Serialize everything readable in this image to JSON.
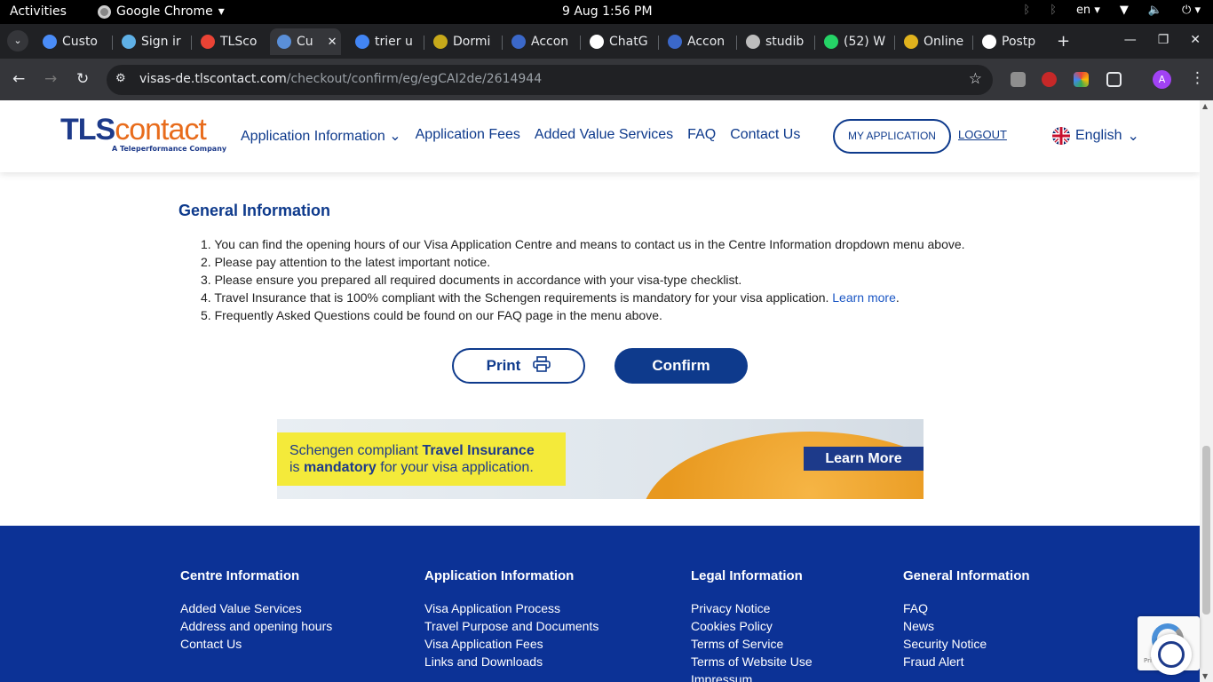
{
  "system_bar": {
    "activities": "Activities",
    "app_name": "Google Chrome",
    "clock": "9 Aug  1:56 PM",
    "language": "en"
  },
  "tabs": [
    {
      "label": "Custo",
      "color": "#4a8cf7"
    },
    {
      "label": "Sign ir",
      "color": "#5fb0e6"
    },
    {
      "label": "TLSco",
      "color": "#ea4335"
    },
    {
      "label": "Cu",
      "color": "#5a8fd8"
    },
    {
      "label": "trier u",
      "color": "#4285f4"
    },
    {
      "label": "Dormi",
      "color": "#c7a91a"
    },
    {
      "label": "Accon",
      "color": "#3b68c9"
    },
    {
      "label": "ChatG",
      "color": "#ffffff"
    },
    {
      "label": "Accon",
      "color": "#3b68c9"
    },
    {
      "label": "studib",
      "color": "#bdbdbd"
    },
    {
      "label": "(52) W",
      "color": "#25d366"
    },
    {
      "label": "Online",
      "color": "#e0b21d"
    },
    {
      "label": "Postp",
      "color": "#ffffff"
    }
  ],
  "address_bar": {
    "host": "visas-de.tlscontact.com",
    "path": "/checkout/confirm/eg/egCAI2de/2614944",
    "avatar_letter": "A"
  },
  "header": {
    "logo_tls": "TLS",
    "logo_contact": "contact",
    "logo_tagline": "A Teleperformance Company",
    "nav": [
      "Application Information",
      "Application Fees",
      "Added Value Services",
      "FAQ",
      "Contact Us"
    ],
    "my_application": "MY APPLICATION",
    "logout": "LOGOUT",
    "language": "English"
  },
  "general_info": {
    "title": "General Information",
    "items": [
      "1. You can find the opening hours of our Visa Application Centre and means to contact us in the Centre Information dropdown menu above.",
      "2. Please pay attention to the latest important notice.",
      "3. Please ensure you prepared all required documents in accordance with your visa-type checklist.",
      "4. Travel Insurance that is 100% compliant with the Schengen requirements is mandatory for your visa application. ",
      "5.  Frequently Asked Questions could be found on our FAQ page in the menu above."
    ],
    "learn_more": "Learn more",
    "learn_more_suffix": "."
  },
  "actions": {
    "print": "Print",
    "confirm": "Confirm"
  },
  "banner": {
    "line1_a": "Schengen compliant ",
    "line1_b": "Travel Insurance",
    "line2_a": "is ",
    "line2_b": "mandatory",
    "line2_c": " for your visa application.",
    "cta": "Learn More"
  },
  "footer": {
    "columns": [
      {
        "title": "Centre Information",
        "links": [
          "Added Value Services",
          "Address and opening hours",
          "Contact Us"
        ]
      },
      {
        "title": "Application Information",
        "links": [
          "Visa Application Process",
          "Travel Purpose and Documents",
          "Visa Application Fees",
          "Links and Downloads"
        ]
      },
      {
        "title": "Legal Information",
        "links": [
          "Privacy Notice",
          "Cookies Policy",
          "Terms of Service",
          "Terms of Website Use",
          "Impressum"
        ]
      },
      {
        "title": "General Information",
        "links": [
          "FAQ",
          "News",
          "Security Notice",
          "Fraud Alert"
        ]
      }
    ]
  },
  "recaptcha_text": "Privacy - Terms",
  "colors": {
    "brand_blue": "#0e3a8c",
    "brand_orange": "#e86c1c",
    "footer_bg": "#0c3296"
  }
}
